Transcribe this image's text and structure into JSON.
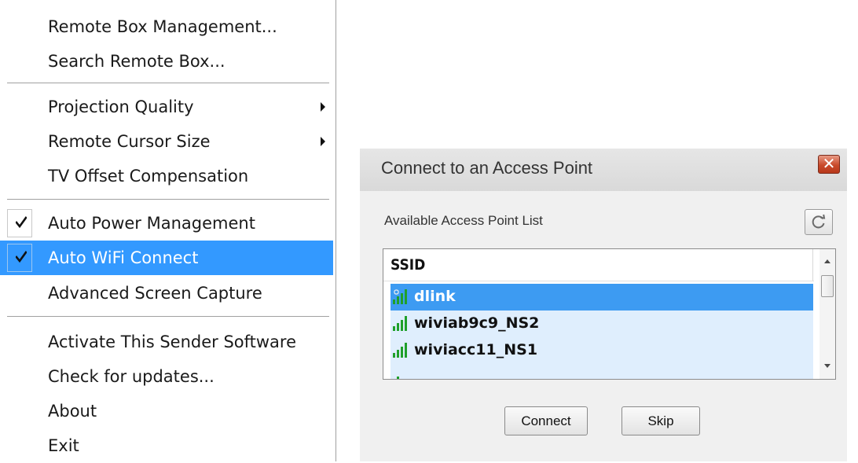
{
  "context_menu": {
    "items": [
      {
        "label": "Remote Box Management..."
      },
      {
        "label": "Search Remote Box..."
      },
      {
        "label": "Projection Quality",
        "has_submenu": true
      },
      {
        "label": "Remote Cursor Size",
        "has_submenu": true
      },
      {
        "label": "TV Offset Compensation"
      },
      {
        "label": "Auto Power Management",
        "checked": true
      },
      {
        "label": "Auto WiFi Connect",
        "checked": true,
        "highlighted": true
      },
      {
        "label": "Advanced Screen Capture"
      },
      {
        "label": "Activate This Sender Software"
      },
      {
        "label": "Check for updates..."
      },
      {
        "label": "About"
      },
      {
        "label": "Exit"
      }
    ]
  },
  "dialog": {
    "title": "Connect to an Access Point",
    "list_label": "Available Access Point List",
    "column_header": "SSID",
    "access_points": [
      {
        "ssid": "dlink",
        "selected": true,
        "secured_icon": true
      },
      {
        "ssid": "wiviab9c9_NS2",
        "selected": false
      },
      {
        "ssid": "wiviacc11_NS1",
        "selected": false
      }
    ],
    "connect_label": "Connect",
    "skip_label": "Skip",
    "close_glyph": "✕"
  },
  "colors": {
    "menu_highlight": "#3399ff",
    "row_selected": "#3d9bf2",
    "row_background": "#dfeefd",
    "signal_green": "#1fa02a",
    "close_button": "#c94a2b"
  },
  "icons": {
    "check": "check-icon",
    "submenu": "submenu-arrow-icon",
    "signal": "wifi-signal-icon",
    "refresh": "refresh-icon",
    "close": "close-icon"
  }
}
